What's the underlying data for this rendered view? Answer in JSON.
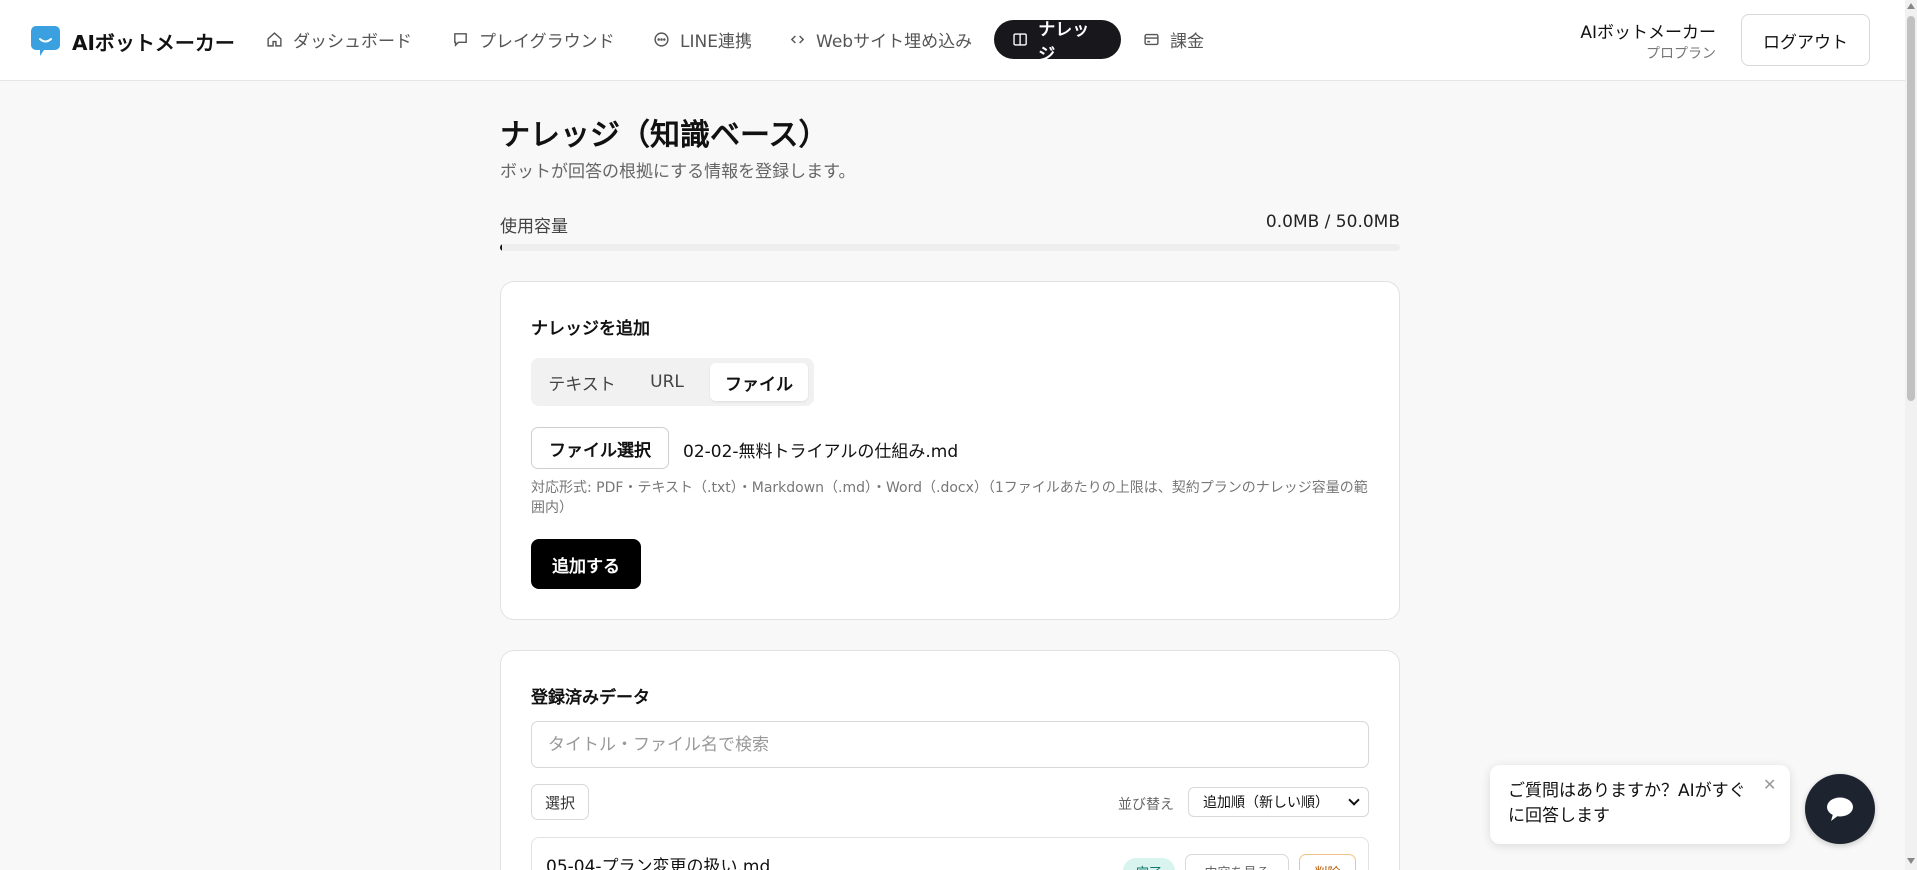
{
  "app": {
    "name": "AIボットメーカー",
    "brand_color": "#3aa0e0"
  },
  "nav": {
    "items": [
      {
        "label": "ダッシュボード",
        "icon": "home-icon"
      },
      {
        "label": "プレイグラウンド",
        "icon": "chat-bubble-icon"
      },
      {
        "label": "LINE連携",
        "icon": "chat-dots-icon"
      },
      {
        "label": "Webサイト埋め込み",
        "icon": "code-icon"
      },
      {
        "label": "ナレッジ",
        "icon": "book-icon",
        "active": true
      },
      {
        "label": "課金",
        "icon": "credit-card-icon"
      }
    ],
    "active_color": "#17171c"
  },
  "user": {
    "name": "AIボットメーカー",
    "plan": "プロプラン",
    "logout_label": "ログアウト"
  },
  "page": {
    "title": "ナレッジ（知識ベース）",
    "subtitle": "ボットが回答の根拠にする情報を登録します。"
  },
  "usage": {
    "label": "使用容量",
    "value": "0.0MB / 50.0MB",
    "fraction": 0.0
  },
  "add_card": {
    "title": "ナレッジを追加",
    "tabs": [
      {
        "label": "テキスト"
      },
      {
        "label": "URL"
      },
      {
        "label": "ファイル",
        "active": true
      }
    ],
    "file_button_label": "ファイル選択",
    "file_name": "02-02-無料トライアルの仕組み.md",
    "hint": "対応形式: PDF・テキスト（.txt）・Markdown（.md）・Word（.docx）（1ファイルあたりの上限は、契約プランのナレッジ容量の範囲内）",
    "add_button_label": "追加する"
  },
  "list_card": {
    "title": "登録済みデータ",
    "search_placeholder": "タイトル・ファイル名で検索",
    "select_label": "選択",
    "sort_label": "並び替え",
    "sort_value": "追加順（新しい順）",
    "rows": [
      {
        "title": "05-04-プラン変更の扱い.md",
        "status": "完了",
        "view_label": "内容を見る",
        "delete_label": "削除"
      }
    ],
    "status_done_color": "#0f7a6a",
    "danger_color": "#b45a00"
  },
  "chat": {
    "message": "ご質問はありますか？AIがすぐに回答します",
    "close_glyph": "✕",
    "fab_color": "#1e2330"
  }
}
